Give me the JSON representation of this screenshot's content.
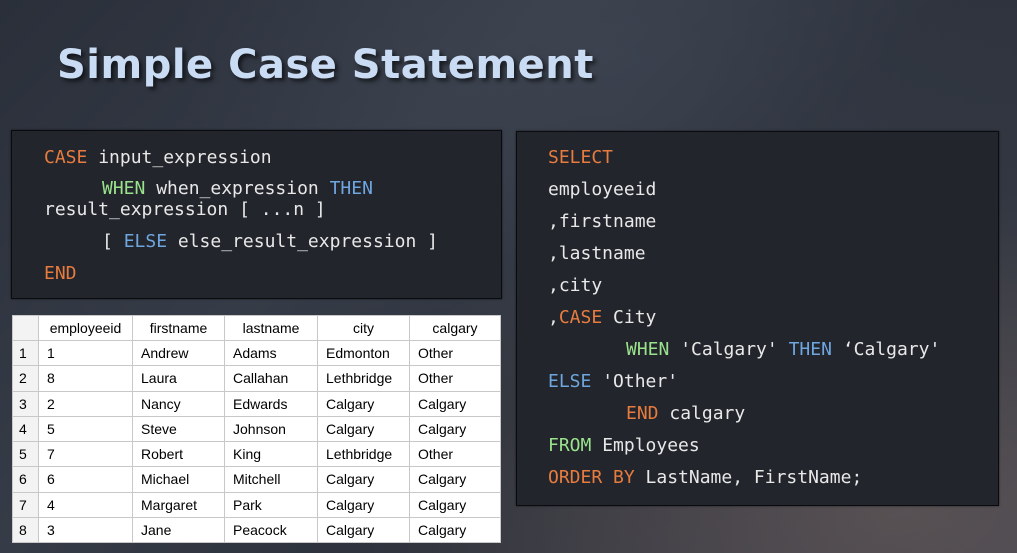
{
  "slide": {
    "title": "Simple Case Statement"
  },
  "syntax": {
    "line1": {
      "kw": "CASE",
      "text": " input_expression"
    },
    "line2": {
      "kw_when": "WHEN",
      "mid": " when_expression ",
      "kw_then": "THEN"
    },
    "line3": {
      "text": "result_expression [ ...n ]"
    },
    "line4": {
      "open": "[ ",
      "kw": "ELSE",
      "text": " else_result_expression ]"
    },
    "line5": {
      "kw": "END"
    }
  },
  "query": {
    "select": "SELECT",
    "col1": "employeeid",
    "col2": ",firstname",
    "col3": ",lastname",
    "col4": ",city",
    "case_prefix": ",",
    "case_kw": "CASE",
    "case_text": " City",
    "when_kw": "WHEN",
    "when_val": " 'Calgary' ",
    "then_kw": "THEN",
    "then_val": " ‘Calgary'",
    "else_kw": "ELSE",
    "else_val": " 'Other'",
    "end_kw": "END",
    "end_text": " calgary",
    "from_kw": "FROM",
    "from_text": " Employees",
    "order_kw": "ORDER BY",
    "order_text": " LastName, FirstName;"
  },
  "result_table": {
    "headers": [
      "",
      "employeeid",
      "firstname",
      "lastname",
      "city",
      "calgary"
    ],
    "rows": [
      [
        "1",
        "1",
        "Andrew",
        "Adams",
        "Edmonton",
        "Other"
      ],
      [
        "2",
        "8",
        "Laura",
        "Callahan",
        "Lethbridge",
        "Other"
      ],
      [
        "3",
        "2",
        "Nancy",
        "Edwards",
        "Calgary",
        "Calgary"
      ],
      [
        "4",
        "5",
        "Steve",
        "Johnson",
        "Calgary",
        "Calgary"
      ],
      [
        "5",
        "7",
        "Robert",
        "King",
        "Lethbridge",
        "Other"
      ],
      [
        "6",
        "6",
        "Michael",
        "Mitchell",
        "Calgary",
        "Calgary"
      ],
      [
        "7",
        "4",
        "Margaret",
        "Park",
        "Calgary",
        "Calgary"
      ],
      [
        "8",
        "3",
        "Jane",
        "Peacock",
        "Calgary",
        "Calgary"
      ]
    ]
  },
  "colors": {
    "keyword_orange": "#e87c3e",
    "keyword_green": "#9be28c",
    "keyword_blue": "#6fa6df",
    "title": "#c9dcf4"
  }
}
